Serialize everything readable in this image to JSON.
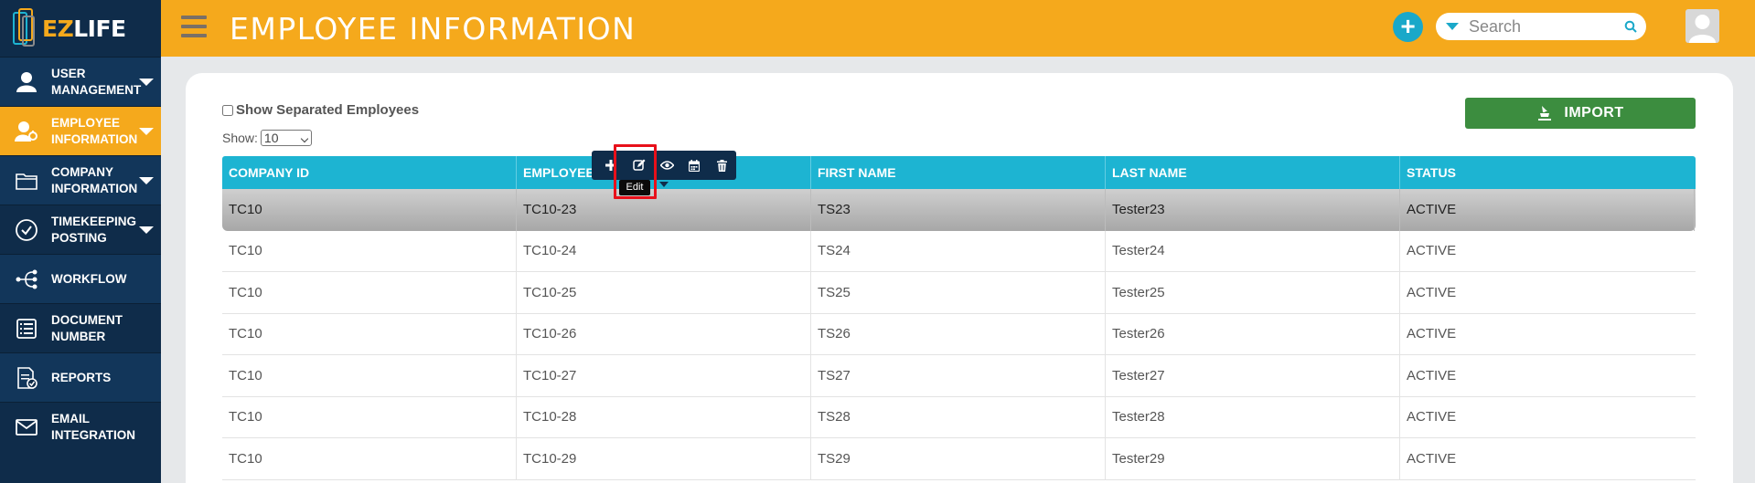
{
  "brand": {
    "logo_ez": "EZ",
    "logo_life": "LIFE"
  },
  "sidebar": {
    "items": [
      {
        "label": "User Management",
        "icon": "user-icon",
        "expandable": true,
        "active": false
      },
      {
        "label": "Employee Information",
        "icon": "employee-icon",
        "expandable": true,
        "active": true
      },
      {
        "label": "Company Information",
        "icon": "folder-icon",
        "expandable": true,
        "active": false
      },
      {
        "label": "Timekeeping Posting",
        "icon": "check-circle-icon",
        "expandable": true,
        "active": false
      },
      {
        "label": "Workflow",
        "icon": "workflow-icon",
        "expandable": false,
        "active": false
      },
      {
        "label": "Document Number",
        "icon": "document-list-icon",
        "expandable": false,
        "active": false
      },
      {
        "label": "Reports",
        "icon": "report-icon",
        "expandable": false,
        "active": false
      },
      {
        "label": "Email Integration",
        "icon": "mail-icon",
        "expandable": false,
        "active": false
      }
    ]
  },
  "header": {
    "title": "EMPLOYEE INFORMATION",
    "add_symbol": "+",
    "search_placeholder": "Search"
  },
  "controls": {
    "show_separated_label": "Show Separated Employees",
    "show_separated_checked": false,
    "show_label": "Show:",
    "show_value": "10",
    "import_label": "IMPORT"
  },
  "table": {
    "columns": [
      "COMPANY ID",
      "EMPLOYEE ID",
      "FIRST NAME",
      "LAST NAME",
      "STATUS"
    ],
    "rows": [
      [
        "TC10",
        "TC10-23",
        "TS23",
        "Tester23",
        "ACTIVE"
      ],
      [
        "TC10",
        "TC10-24",
        "TS24",
        "Tester24",
        "ACTIVE"
      ],
      [
        "TC10",
        "TC10-25",
        "TS25",
        "Tester25",
        "ACTIVE"
      ],
      [
        "TC10",
        "TC10-26",
        "TS26",
        "Tester26",
        "ACTIVE"
      ],
      [
        "TC10",
        "TC10-27",
        "TS27",
        "Tester27",
        "ACTIVE"
      ],
      [
        "TC10",
        "TC10-28",
        "TS28",
        "Tester28",
        "ACTIVE"
      ],
      [
        "TC10",
        "TC10-29",
        "TS29",
        "Tester29",
        "ACTIVE"
      ]
    ],
    "selected_row": 0
  },
  "action_bar": {
    "actions": [
      "add-icon",
      "edit-icon",
      "view-icon",
      "calendar-icon",
      "delete-icon"
    ],
    "tooltip": "Edit"
  },
  "colors": {
    "header": "#f5a91c",
    "sidebar": "#0f2c4a",
    "table_header": "#1db4d2",
    "import_button": "#3c8d3f",
    "highlight": "#e8101a"
  }
}
